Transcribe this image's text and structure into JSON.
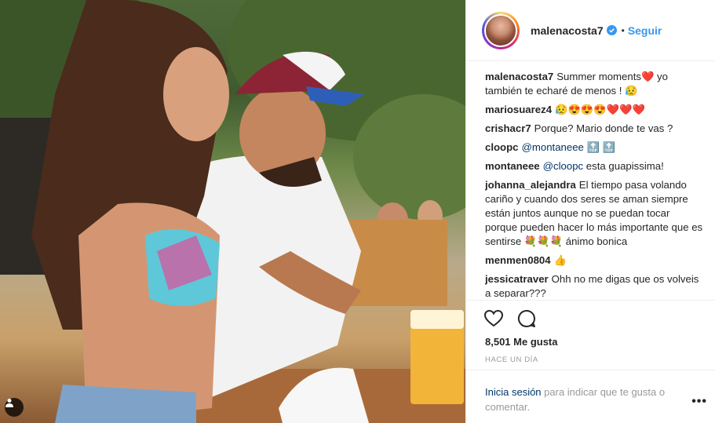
{
  "post": {
    "username": "malenacosta7",
    "follow_label": "Seguir",
    "separator": "•",
    "likes": "8,501 Me gusta",
    "time": "HACE UN DÍA",
    "login_link": "Inicia sesión",
    "login_text": " para indicar que te gusta o comentar.",
    "more_label": "•••"
  },
  "comments": [
    {
      "user": "malenacosta7",
      "text": "Summer moments❤️ yo también te echaré de menos ! 😥"
    },
    {
      "user": "mariosuarez4",
      "text": "😥😍😍😍❤️❤️❤️"
    },
    {
      "user": "crishacr7",
      "text": "Porque? Mario donde te vas ?"
    },
    {
      "user": "cloopc",
      "mention": "@montaneee",
      "text": " 🔝 🔝"
    },
    {
      "user": "montaneee",
      "mention": "@cloopc",
      "text": " esta guapissima!"
    },
    {
      "user": "johanna_alejandra",
      "text": "El tiempo pasa volando cariño y cuando dos seres se aman siempre están juntos aunque no se puedan tocar porque pueden hacer lo más importante que es sentirse 💐💐💐 ánimo bonica"
    },
    {
      "user": "menmen0804",
      "text": "👍"
    },
    {
      "user": "jessicatraver",
      "text": "Ohh no me digas que os volveis a separar???"
    }
  ],
  "icons": {
    "verified": "verified-badge-icon",
    "heart": "heart-icon",
    "comment": "comment-icon",
    "user_tag": "user-tag-icon"
  },
  "colors": {
    "link": "#3897f0",
    "mention": "#003569",
    "muted": "#999999"
  }
}
